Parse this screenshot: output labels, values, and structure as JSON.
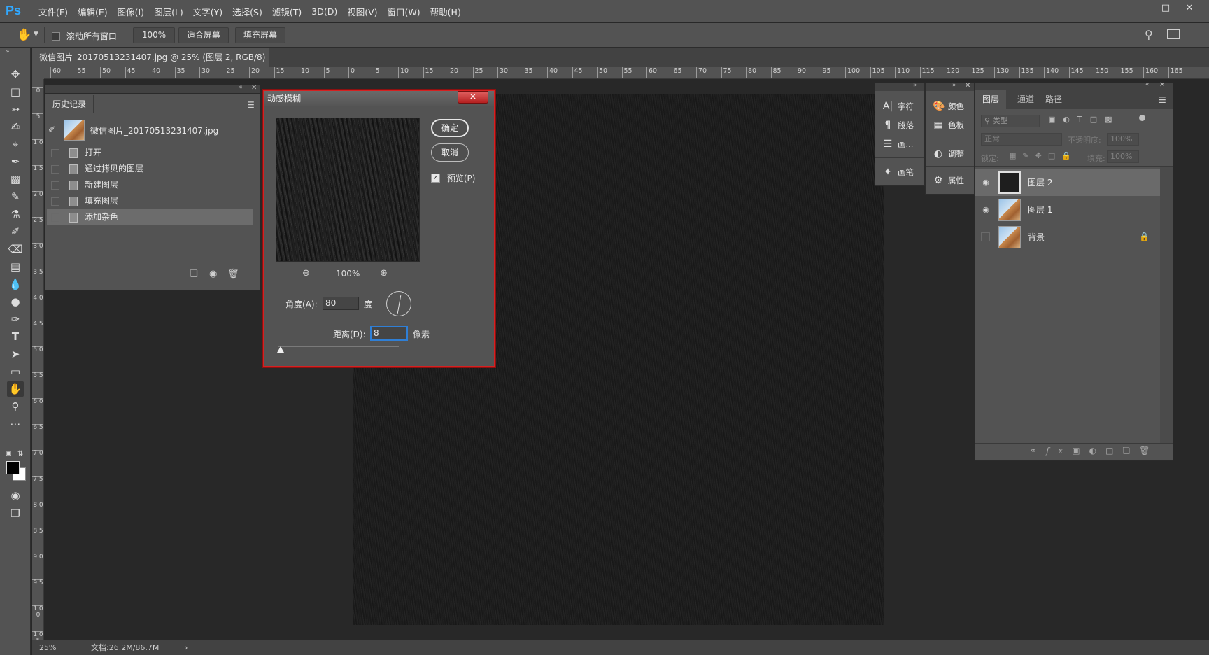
{
  "app": {
    "logo": "Ps"
  },
  "menu": [
    "文件(F)",
    "编辑(E)",
    "图像(I)",
    "图层(L)",
    "文字(Y)",
    "选择(S)",
    "滤镜(T)",
    "3D(D)",
    "视图(V)",
    "窗口(W)",
    "帮助(H)"
  ],
  "options_bar": {
    "scroll_all_label": "滚动所有窗口",
    "zoom_value": "100%",
    "fit_screen": "适合屏幕",
    "fill_screen": "填充屏幕"
  },
  "document": {
    "tab_title": "微信图片_20170513231407.jpg @ 25% (图层 2, RGB/8) *",
    "close": "×"
  },
  "ruler": {
    "h_ticks": [
      "60",
      "55",
      "50",
      "45",
      "40",
      "35",
      "30",
      "25",
      "20",
      "15",
      "10",
      "5",
      "0",
      "5",
      "10",
      "15",
      "20",
      "25",
      "30",
      "35",
      "40",
      "45",
      "50",
      "55",
      "60",
      "65",
      "70",
      "75",
      "80",
      "85",
      "90",
      "95",
      "100",
      "105",
      "110",
      "115",
      "120",
      "125",
      "130",
      "135",
      "140",
      "145",
      "150",
      "155",
      "160",
      "165"
    ],
    "v_ticks": [
      "0",
      "5",
      "1 0",
      "1 5",
      "2 0",
      "2 5",
      "3 0",
      "3 5",
      "4 0",
      "4 5",
      "5 0",
      "5 5",
      "6 0",
      "6 5",
      "7 0",
      "7 5",
      "8 0",
      "8 5",
      "9 0",
      "9 5",
      "1 0 0",
      "1 0 5"
    ]
  },
  "status": {
    "zoom": "25%",
    "doc_info": "文档:26.2M/86.7M",
    "arrow": "›"
  },
  "history": {
    "tab": "历史记录",
    "snapshot": "微信图片_20170513231407.jpg",
    "items": [
      "打开",
      "通过拷贝的图层",
      "新建图层",
      "填充图层",
      "添加杂色"
    ],
    "selected_index": 4
  },
  "dialog": {
    "title": "动感模糊",
    "close": "×",
    "ok": "确定",
    "cancel": "取消",
    "preview_label": "预览(P)",
    "preview_checked": true,
    "zoom": "100%",
    "angle_label": "角度(A):",
    "angle_value": "80",
    "angle_unit": "度",
    "distance_label": "距离(D):",
    "distance_value": "8",
    "distance_unit": "像素"
  },
  "dock1": {
    "items": [
      "字符",
      "段落",
      "画...",
      "画笔"
    ]
  },
  "dock2": {
    "items": [
      "颜色",
      "色板",
      "调整",
      "属性"
    ]
  },
  "layers": {
    "tabs": [
      "图层",
      "通道",
      "路径"
    ],
    "filter_placeholder": "类型",
    "blend_mode": "正常",
    "opacity_label": "不透明度:",
    "opacity_value": "100%",
    "lock_label": "锁定:",
    "fill_label": "填充:",
    "fill_value": "100%",
    "items": [
      {
        "name": "图层 2",
        "visible": true,
        "selected": true,
        "thumb": "dark"
      },
      {
        "name": "图层 1",
        "visible": true,
        "selected": false,
        "thumb": "photo"
      },
      {
        "name": "背景",
        "visible": false,
        "selected": false,
        "thumb": "photo",
        "locked": true
      }
    ]
  }
}
